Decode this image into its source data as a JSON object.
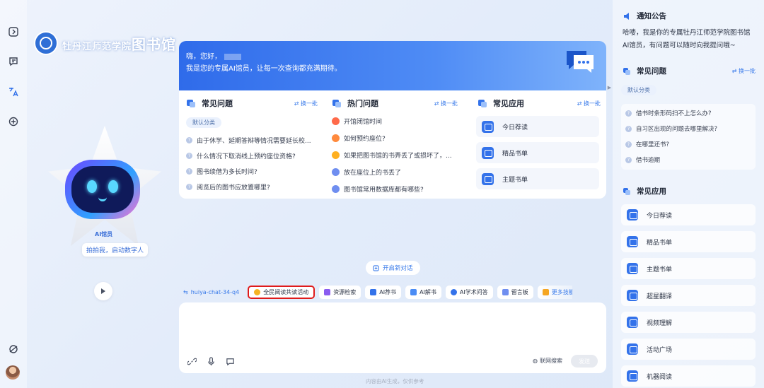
{
  "logo": {
    "school": "牡丹江师范学院",
    "library": "图书馆"
  },
  "greeting": {
    "hi": "嗨，您好，",
    "message": "我是您的专属AI馆员，让每一次查询都充满期待。"
  },
  "robot": {
    "badge": "AI馆员",
    "tip": "拍拍我，启动数字人"
  },
  "faq": {
    "title": "常见问题",
    "refresh": "换一批",
    "chip": "默认分类",
    "items": [
      "由于休学、延期答辩等情况需要延长校...",
      "什么情况下取消线上预约座位资格?",
      "图书续借为多长时间?",
      "阅览后的图书应放置哪里?"
    ]
  },
  "hot": {
    "title": "热门问题",
    "refresh": "换一批",
    "items": [
      "开馆闭馆时间",
      "如何预约座位?",
      "如果把图书馆的书弄丢了或损坏了，...",
      "放在座位上的书丢了",
      "图书馆常用数据库都有哪些?"
    ],
    "colors": [
      "#ff6a4a",
      "#ff8a3d",
      "#ffb020",
      "#6f8ef0",
      "#6f8ef0"
    ]
  },
  "apps": {
    "title": "常见应用",
    "refresh": "换一批",
    "items": [
      "今日荐读",
      "精品书单",
      "主题书单"
    ]
  },
  "chat": {
    "new_chat": "开启新对话",
    "model": "huiya-chat-34-q4",
    "tools": [
      "全民阅读共读活动",
      "资源检索",
      "AI荐书",
      "AI解书",
      "AI学术问答",
      "留言板",
      "更多技能"
    ],
    "web_search": "联网搜索",
    "send": "发送",
    "footer": "内容由AI生成，仅供参考"
  },
  "right": {
    "notice_title": "通知公告",
    "notice_text": "哈喽，我是你的专属牡丹江师范学院图书馆AI馆员，有问题可以随时向我提问哦~",
    "faq_title": "常见问题",
    "faq_refresh": "换一批",
    "faq_chip": "默认分类",
    "faq_items": [
      "借书时条形码扫不上怎么办?",
      "自习区出现的问题去哪里解决?",
      "在哪里还书?",
      "借书逾期"
    ],
    "apps_title": "常见应用",
    "apps": [
      "今日荐读",
      "精品书单",
      "主题书单",
      "超星翻译",
      "视频理解",
      "活动广场",
      "机器阅读"
    ]
  },
  "colors": {
    "accent": "#3372ea",
    "highlight": "#e01b1b"
  }
}
